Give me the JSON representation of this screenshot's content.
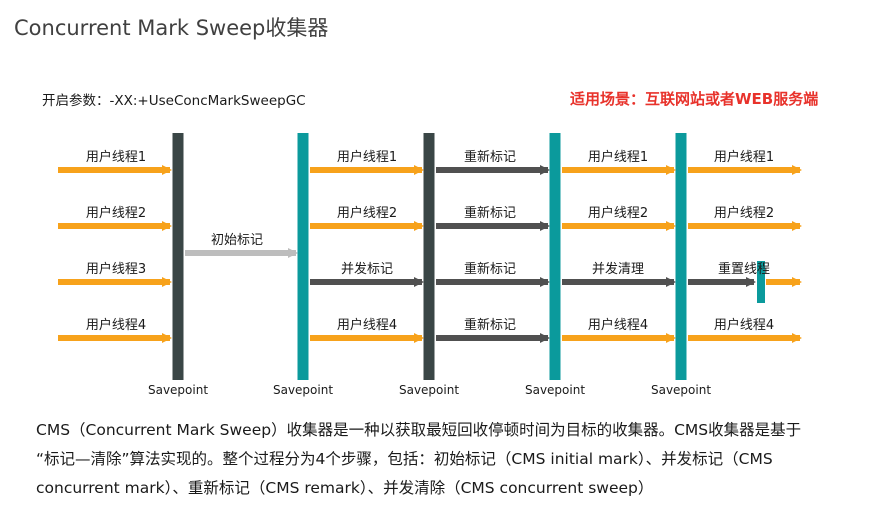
{
  "title": "Concurrent Mark Sweep收集器",
  "param": "开启参数：-XX:+UseConcMarkSweepGC",
  "scenario": "适用场景：互联网站或者WEB服务端",
  "colors": {
    "user_thread": "#f7a21b",
    "gc_thread": "#505050",
    "initial_mark": "#bdbdbd",
    "savepoint_dark": "#3a4646",
    "savepoint_teal": "#0b9a9c",
    "highlight": "#e8322b"
  },
  "savepoint_label": "Savepoint",
  "phases": [
    {
      "name": "user-run-1",
      "rows": [
        {
          "label": "用户线程1",
          "kind": "user"
        },
        {
          "label": "用户线程2",
          "kind": "user"
        },
        {
          "label": "用户线程3",
          "kind": "user"
        },
        {
          "label": "用户线程4",
          "kind": "user"
        }
      ]
    },
    {
      "name": "initial-mark",
      "rows": [
        {
          "label": "初始标记",
          "kind": "initial"
        }
      ]
    },
    {
      "name": "concurrent-mark",
      "rows": [
        {
          "label": "用户线程1",
          "kind": "user"
        },
        {
          "label": "用户线程2",
          "kind": "user"
        },
        {
          "label": "并发标记",
          "kind": "gc"
        },
        {
          "label": "用户线程4",
          "kind": "user"
        }
      ]
    },
    {
      "name": "remark",
      "rows": [
        {
          "label": "重新标记",
          "kind": "gc"
        },
        {
          "label": "重新标记",
          "kind": "gc"
        },
        {
          "label": "重新标记",
          "kind": "gc"
        },
        {
          "label": "重新标记",
          "kind": "gc"
        }
      ]
    },
    {
      "name": "concurrent-sweep",
      "rows": [
        {
          "label": "用户线程1",
          "kind": "user"
        },
        {
          "label": "用户线程2",
          "kind": "user"
        },
        {
          "label": "并发清理",
          "kind": "gc"
        },
        {
          "label": "用户线程4",
          "kind": "user"
        }
      ]
    },
    {
      "name": "reset",
      "rows": [
        {
          "label": "用户线程1",
          "kind": "user"
        },
        {
          "label": "用户线程2",
          "kind": "user"
        },
        {
          "label": "重置线程",
          "kind": "gc"
        },
        {
          "label": "用户线程4",
          "kind": "user"
        }
      ]
    }
  ],
  "description": [
    "CMS（Concurrent Mark Sweep）收集器是一种以获取最短回收停顿时间为目标的收集器。CMS收集器是基于",
    "“标记—清除”算法实现的。整个过程分为4个步骤，包括：初始标记（CMS initial mark）、并发标记（CMS",
    "concurrent mark）、重新标记（CMS remark）、并发清除（CMS concurrent sweep）"
  ]
}
